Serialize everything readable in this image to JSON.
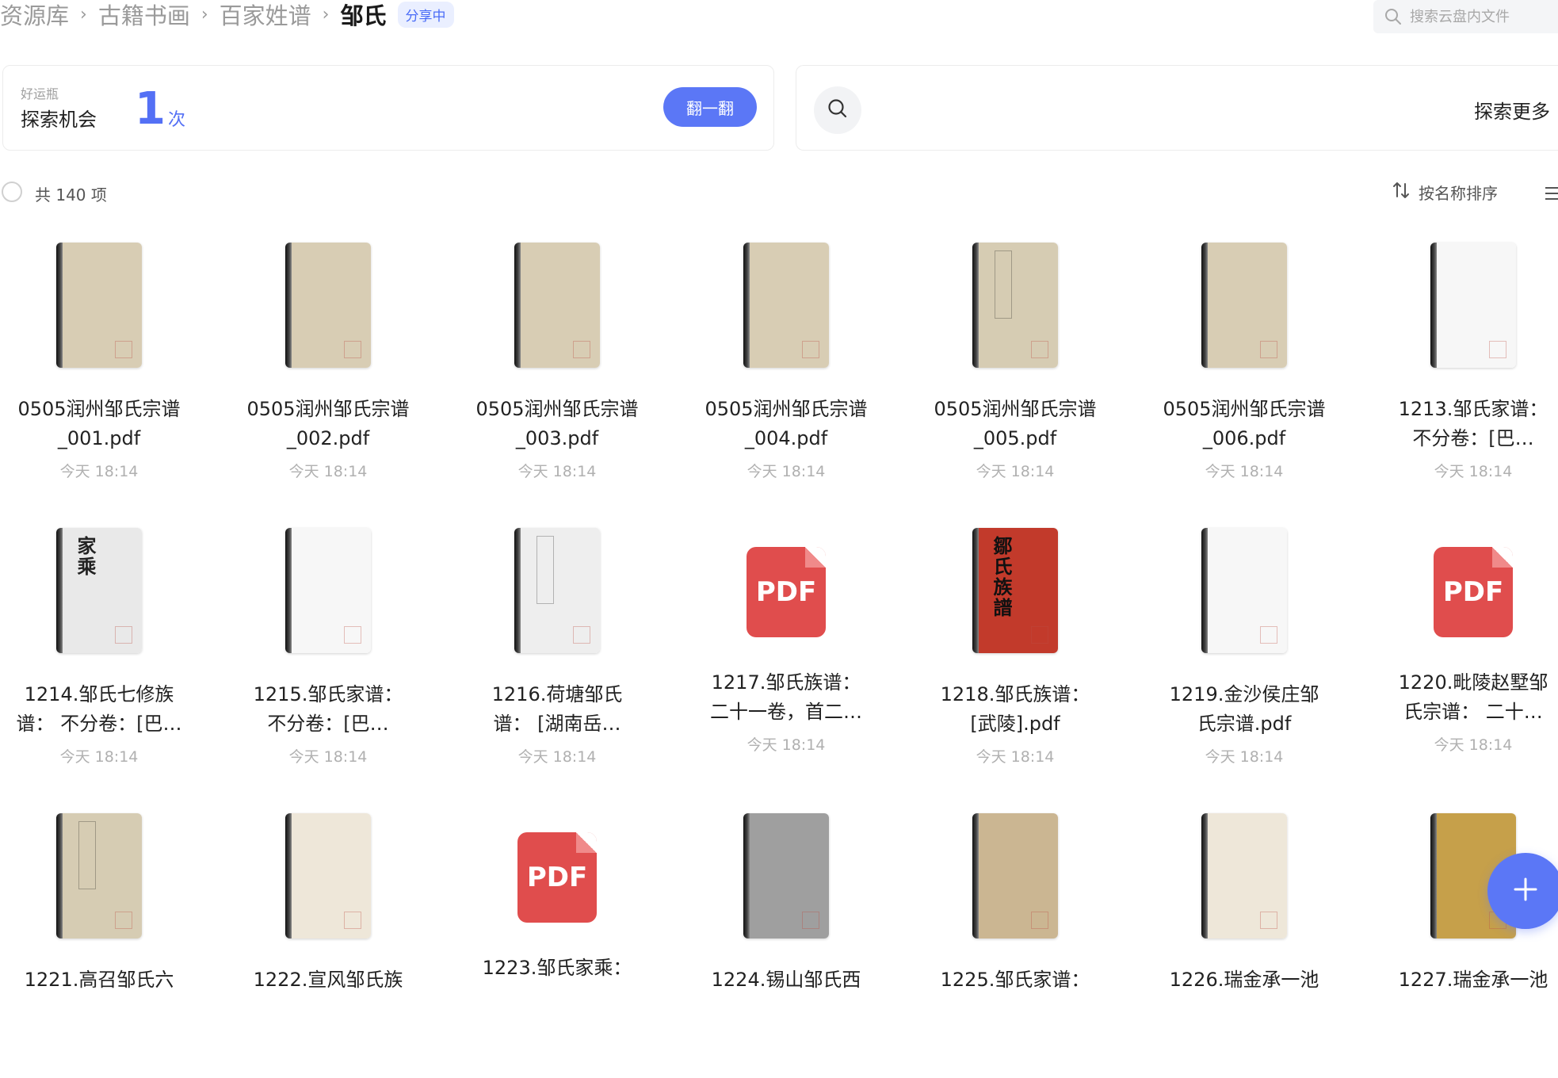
{
  "breadcrumb": {
    "items": [
      "资源库",
      "古籍书画",
      "百家姓谱"
    ],
    "current": "邹氏",
    "badge": "分享中"
  },
  "search": {
    "placeholder": "搜索云盘内文件"
  },
  "lucky": {
    "small_label": "好运瓶",
    "label": "探索机会",
    "count": "1",
    "unit": "次",
    "button": "翻一翻"
  },
  "explore": {
    "label": "探索更多"
  },
  "toolbar": {
    "total": "共 140 项",
    "sort_label": "按名称排序"
  },
  "colors": {
    "accent": "#5b77f6",
    "pdf_red": "#e04d4d",
    "muted": "#b0b0b0"
  },
  "files": [
    {
      "name": "0505润州邹氏宗谱_001.pdf",
      "date": "今天 18:14",
      "thumb": "plain-beige"
    },
    {
      "name": "0505润州邹氏宗谱_002.pdf",
      "date": "今天 18:14",
      "thumb": "plain-beige"
    },
    {
      "name": "0505润州邹氏宗谱_003.pdf",
      "date": "今天 18:14",
      "thumb": "plain-beige"
    },
    {
      "name": "0505润州邹氏宗谱_004.pdf",
      "date": "今天 18:14",
      "thumb": "plain-beige"
    },
    {
      "name": "0505润州邹氏宗谱_005.pdf",
      "date": "今天 18:14",
      "thumb": "label-beige"
    },
    {
      "name": "0505润州邹氏宗谱_006.pdf",
      "date": "今天 18:14",
      "thumb": "plain-beige"
    },
    {
      "name": "1213.邹氏家谱：不分卷：[巴…",
      "date": "今天 18:14",
      "thumb": "white"
    },
    {
      "name": "1214.邹氏七修族谱： 不分卷：[巴…",
      "date": "今天 18:14",
      "thumb": "print-white",
      "glyphs": "家乘"
    },
    {
      "name": "1215.邹氏家谱：不分卷：[巴…",
      "date": "今天 18:14",
      "thumb": "white"
    },
    {
      "name": "1216.荷塘邹氏谱： [湖南岳…",
      "date": "今天 18:14",
      "thumb": "label-white"
    },
    {
      "name": "1217.邹氏族谱：二十一卷，首二…",
      "date": "今天 18:14",
      "thumb": "pdf"
    },
    {
      "name": "1218.邹氏族谱：[武陵].pdf",
      "date": "今天 18:14",
      "thumb": "red",
      "glyphs": "鄒氏族譜"
    },
    {
      "name": "1219.金沙侯庄邹氏宗谱.pdf",
      "date": "今天 18:14",
      "thumb": "white"
    },
    {
      "name": "1220.毗陵赵墅邹氏宗谱： 二十…",
      "date": "今天 18:14",
      "thumb": "pdf"
    },
    {
      "name": "1221.高召邹氏六",
      "date": "",
      "thumb": "label-beige"
    },
    {
      "name": "1222.宣风邹氏族",
      "date": "",
      "thumb": "light-beige"
    },
    {
      "name": "1223.邹氏家乘：",
      "date": "",
      "thumb": "pdf"
    },
    {
      "name": "1224.锡山邹氏西",
      "date": "",
      "thumb": "gray"
    },
    {
      "name": "1225.邹氏家谱：",
      "date": "",
      "thumb": "aged"
    },
    {
      "name": "1226.瑞金承一池",
      "date": "",
      "thumb": "light-beige"
    },
    {
      "name": "1227.瑞金承一池",
      "date": "",
      "thumb": "gold"
    }
  ]
}
